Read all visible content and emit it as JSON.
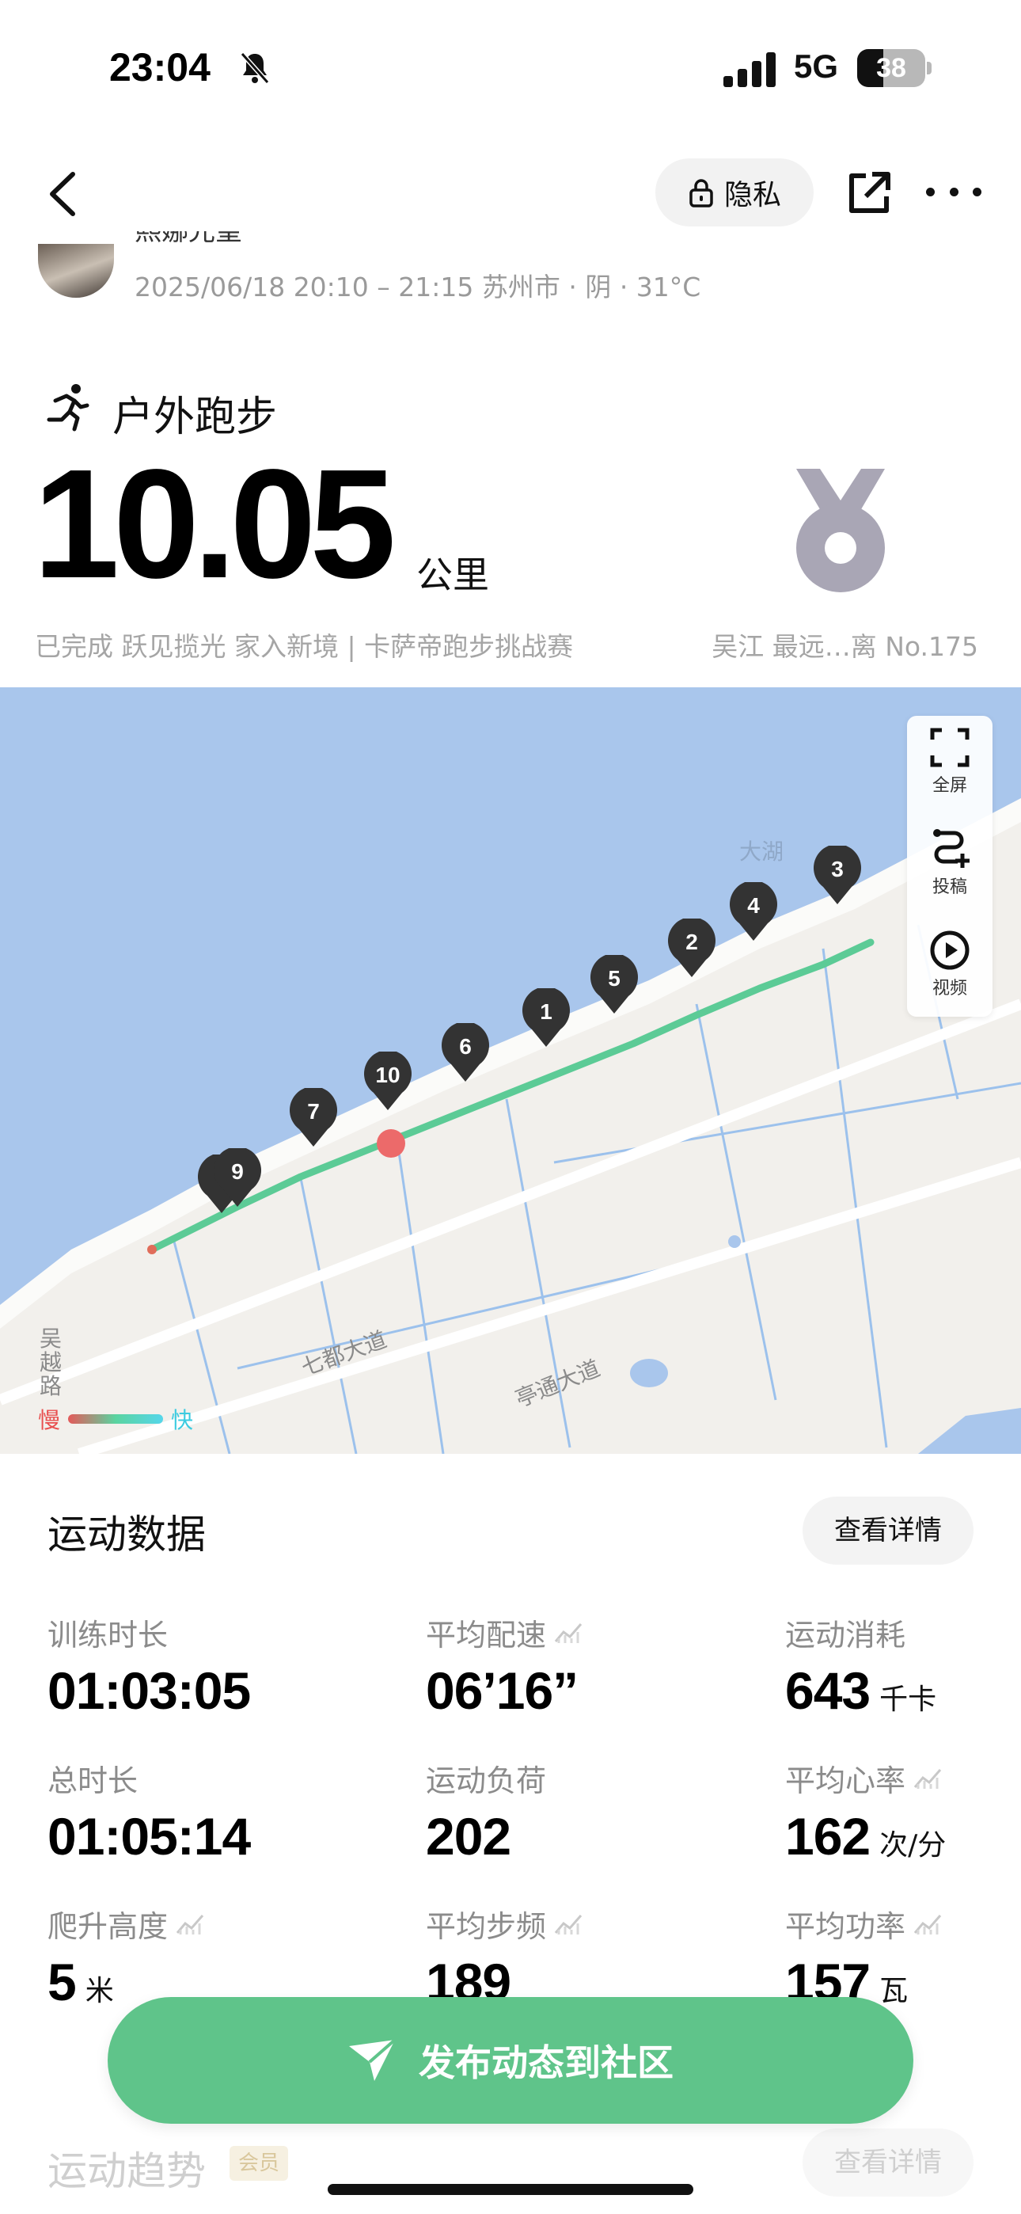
{
  "status_bar": {
    "time": "23:04",
    "network": "5G",
    "battery": "38",
    "battery_level": 0.38
  },
  "header": {
    "privacy_label": "隐私"
  },
  "profile": {
    "username": "熙娜光皇",
    "meta": "2025/06/18 20:10 – 21:15 苏州市 · 阴 · 31°C"
  },
  "activity": {
    "type": "户外跑步",
    "distance": "10.05",
    "unit": "公里",
    "event": "已完成 跃见揽光 家入新境 | 卡萨帝跑步挑战赛",
    "rank": "吴江 最远…离 No.175"
  },
  "map": {
    "tools": [
      {
        "name": "fullscreen",
        "label": "全屏"
      },
      {
        "name": "cast",
        "label": "投稿"
      },
      {
        "name": "video",
        "label": "视频"
      }
    ],
    "markers": [
      "3",
      "4",
      "2",
      "5",
      "1",
      "6",
      "10",
      "7",
      "9"
    ],
    "labels": {
      "lake": "大湖",
      "road1": "吴越路",
      "road2": "七都大道",
      "road3": "亭通大道"
    },
    "legend": {
      "slow": "慢",
      "fast": "快"
    }
  },
  "stats": {
    "title": "运动数据",
    "detail_label": "查看详情",
    "items": [
      {
        "label": "训练时长",
        "value": "01:03:05",
        "unit": ""
      },
      {
        "label": "平均配速",
        "value": "06’16”",
        "unit": ""
      },
      {
        "label": "运动消耗",
        "value": "643",
        "unit": "千卡"
      },
      {
        "label": "总时长",
        "value": "01:05:14",
        "unit": ""
      },
      {
        "label": "运动负荷",
        "value": "202",
        "unit": ""
      },
      {
        "label": "平均心率",
        "value": "162",
        "unit": "次/分"
      },
      {
        "label": "爬升高度",
        "value": "5",
        "unit": "米"
      },
      {
        "label": "平均步频",
        "value": "189",
        "unit": ""
      },
      {
        "label": "平均功率",
        "value": "157",
        "unit": "瓦"
      }
    ]
  },
  "publish": {
    "label": "发布动态到社区"
  },
  "trend": {
    "title": "运动趋势",
    "badge": "会员",
    "detail_label": "查看详情"
  }
}
